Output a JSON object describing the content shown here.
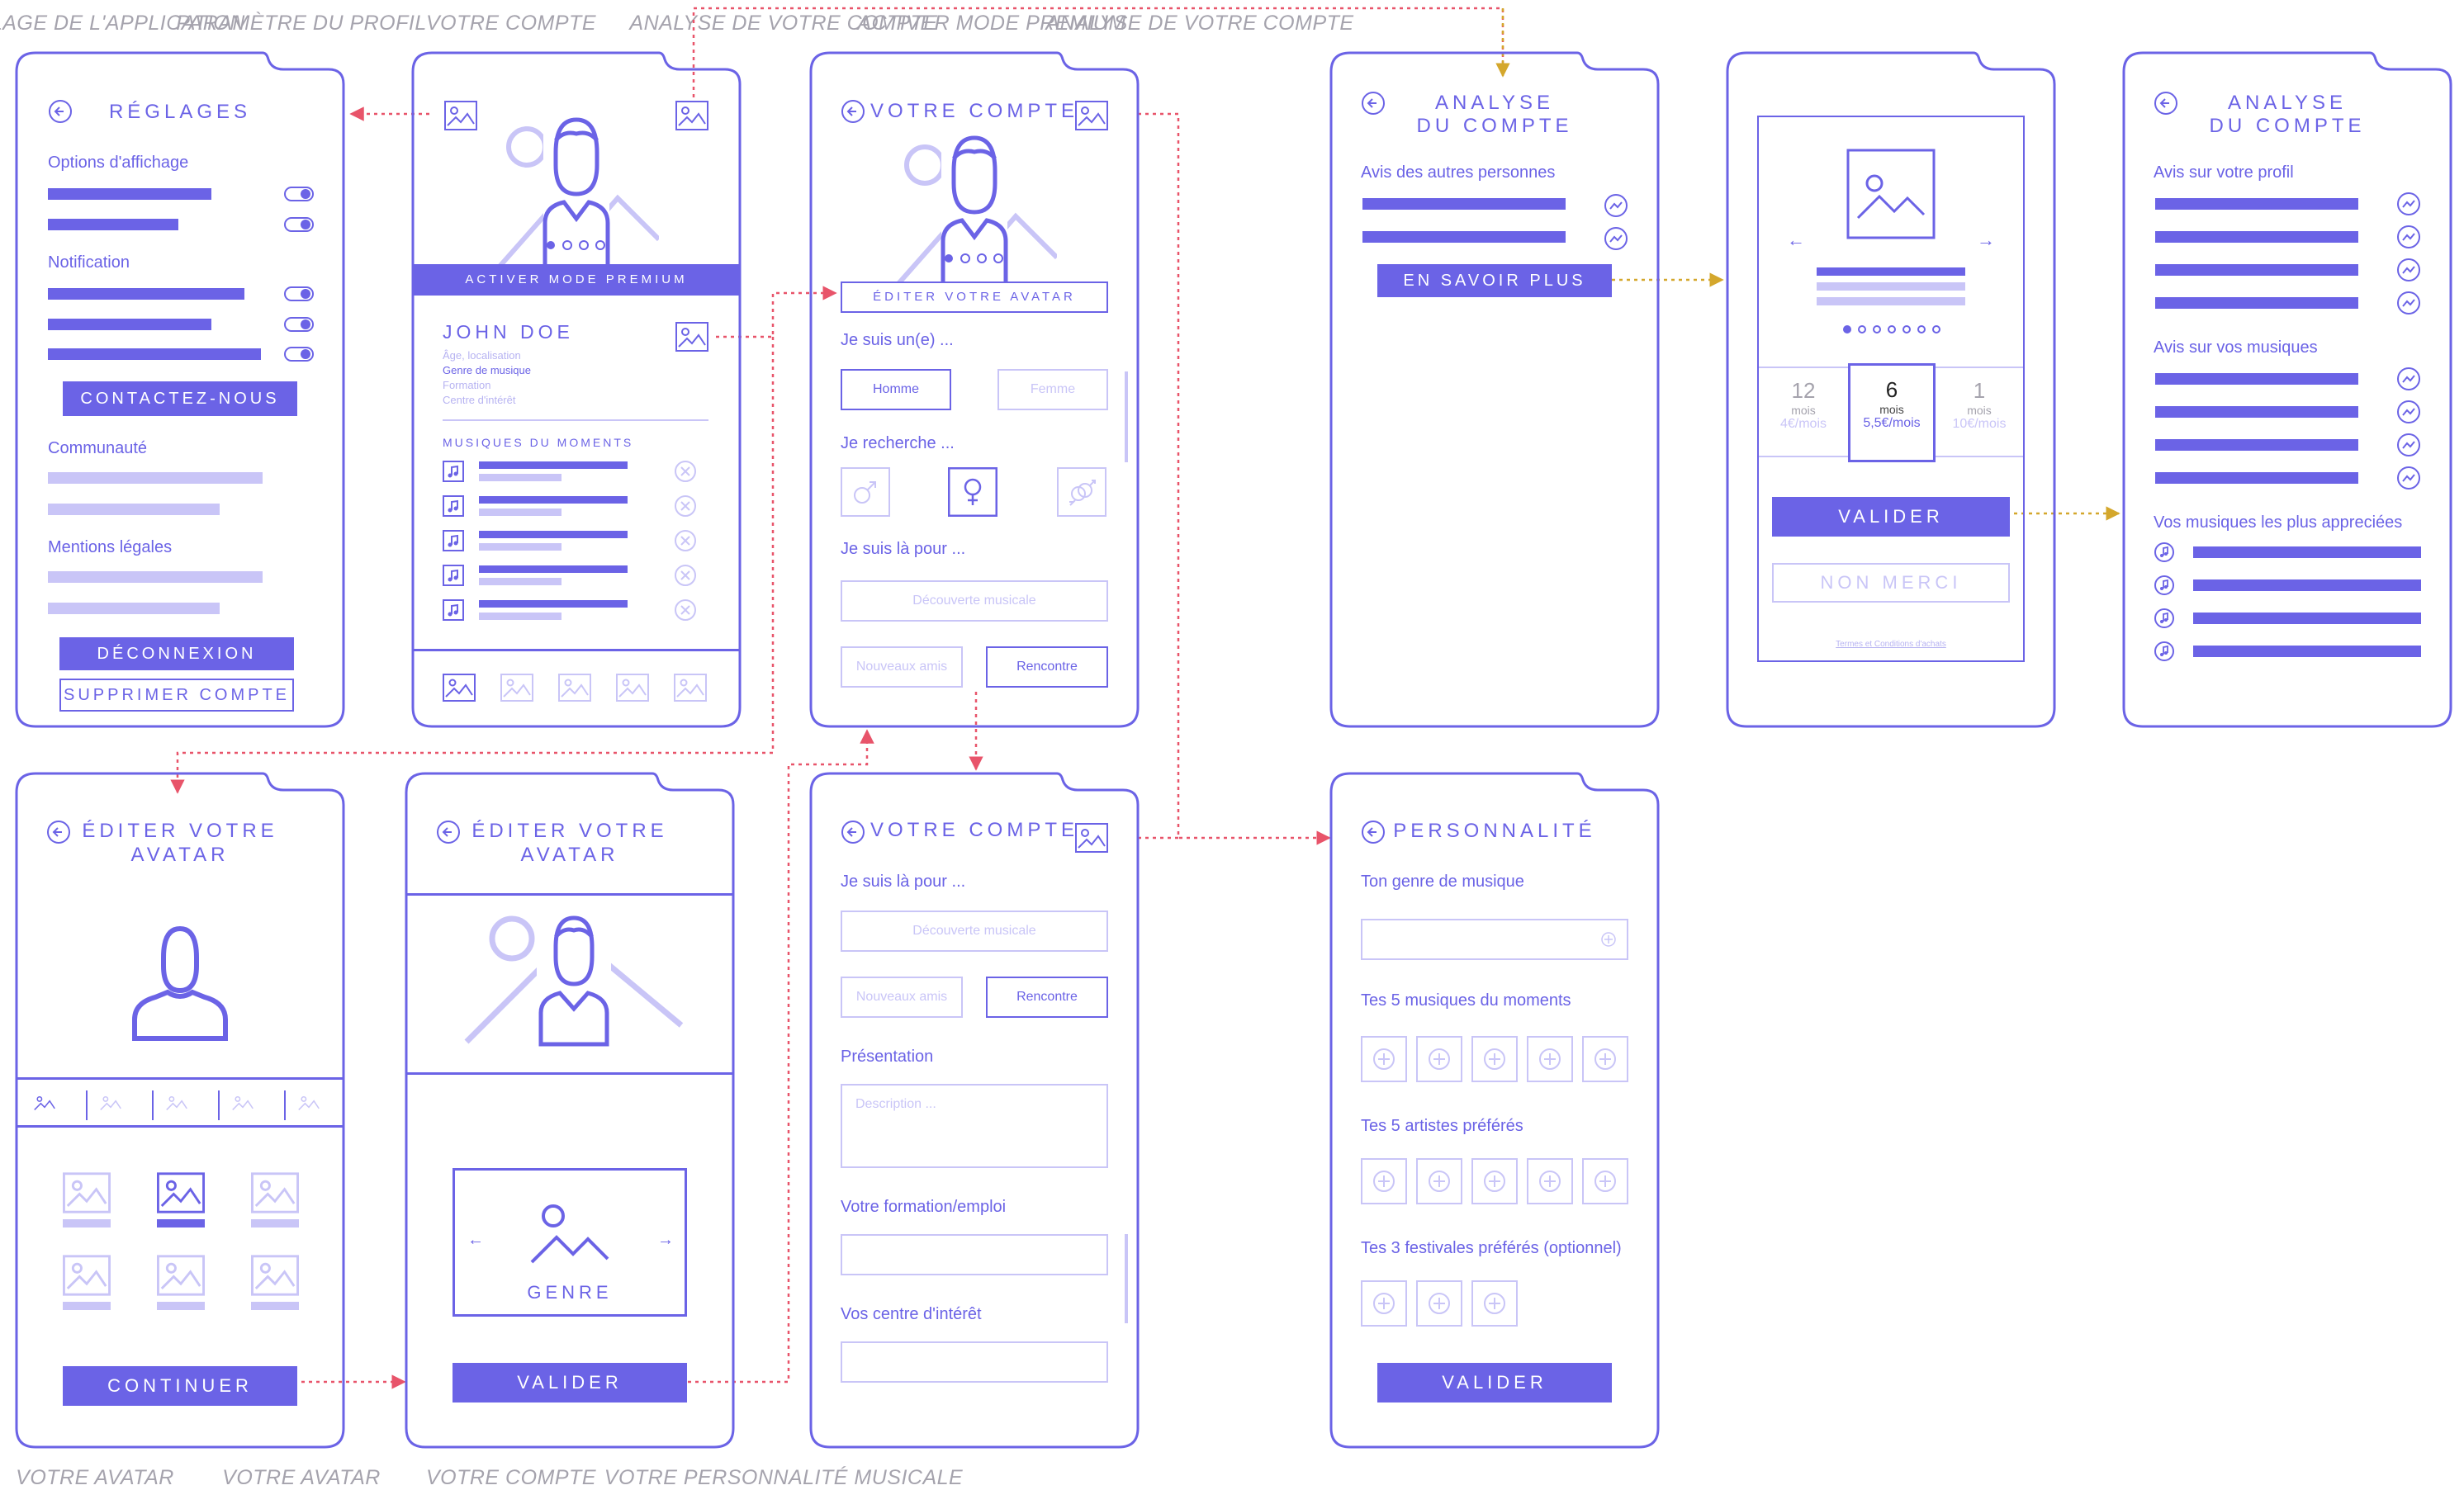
{
  "captions": {
    "top": [
      "RÉGLAGE DE L'APPLICATION",
      "PARAMÈTRE DU PROFIL",
      "VOTRE COMPTE",
      "ANALYSE DE VOTRE COMPTE",
      "ACTIVER MODE PREMIUM",
      "ANALYSE DE VOTRE COMPTE"
    ],
    "bottom": [
      "VOTRE AVATAR",
      "VOTRE AVATAR",
      "VOTRE COMPTE",
      "VOTRE PERSONNALITÉ MUSICALE"
    ]
  },
  "colors": {
    "accent": "#6b63e6",
    "light": "#c9c5f7",
    "link_red": "#e8546a",
    "link_gold": "#d4a72c"
  },
  "settings": {
    "title": "RÉGLAGES",
    "display_options": "Options d'affichage",
    "notification": "Notification",
    "contact": "CONTACTEZ-NOUS",
    "community": "Communauté",
    "legal": "Mentions légales",
    "logout": "DÉCONNEXION",
    "delete": "SUPPRIMER COMPTE"
  },
  "profile": {
    "premium": "ACTIVER MODE PREMIUM",
    "name": "JOHN DOE",
    "info1": "Âge, localisation",
    "info2": "Genre de musique",
    "info3": "Formation",
    "info4": "Centre d'intérêt",
    "moments": "MUSIQUES DU MOMENTS"
  },
  "account1": {
    "title": "VOTRE COMPTE",
    "edit_avatar": "ÉDITER VOTRE AVATAR",
    "i_am": "Je suis un(e) ...",
    "homme": "Homme",
    "femme": "Femme",
    "looking": "Je recherche ...",
    "here_for": "Je suis là pour ...",
    "discover": "Découverte musicale",
    "friends": "Nouveaux amis",
    "meet": "Rencontre"
  },
  "analysis1": {
    "title1": "ANALYSE",
    "title2": "DU COMPTE",
    "others": "Avis des autres personnes",
    "more": "EN SAVOIR PLUS"
  },
  "premium": {
    "p1": {
      "num": "12",
      "unit": "mois",
      "price": "4€/mois"
    },
    "p2": {
      "num": "6",
      "unit": "mois",
      "price": "5,5€/mois"
    },
    "p3": {
      "num": "1",
      "unit": "mois",
      "price": "10€/mois"
    },
    "validate": "VALIDER",
    "no": "NON MERCI",
    "terms": "Termes et Conditions d'achats"
  },
  "analysis2": {
    "title1": "ANALYSE",
    "title2": "DU COMPTE",
    "profile": "Avis sur votre profil",
    "music": "Avis sur vos musiques",
    "fav": "Vos musiques les plus appreciées"
  },
  "avatar1": {
    "title1": "ÉDITER VOTRE",
    "title2": "AVATAR",
    "cont": "CONTINUER"
  },
  "avatar2": {
    "title1": "ÉDITER VOTRE",
    "title2": "AVATAR",
    "genre": "GENRE",
    "validate": "VALIDER"
  },
  "account2": {
    "title": "VOTRE COMPTE",
    "here_for": "Je suis là pour ...",
    "discover": "Découverte musicale",
    "friends": "Nouveaux amis",
    "meet": "Rencontre",
    "pres": "Présentation",
    "desc": "Description ...",
    "job": "Votre formation/emploi",
    "interest": "Vos centre d'intérêt"
  },
  "personality": {
    "title": "PERSONNALITÉ",
    "genre": "Ton genre de musique",
    "five_songs": "Tes 5 musiques du moments",
    "five_artists": "Tes 5 artistes préférés",
    "three_fest": "Tes 3 festivales préférés (optionnel)",
    "validate": "VALIDER"
  }
}
